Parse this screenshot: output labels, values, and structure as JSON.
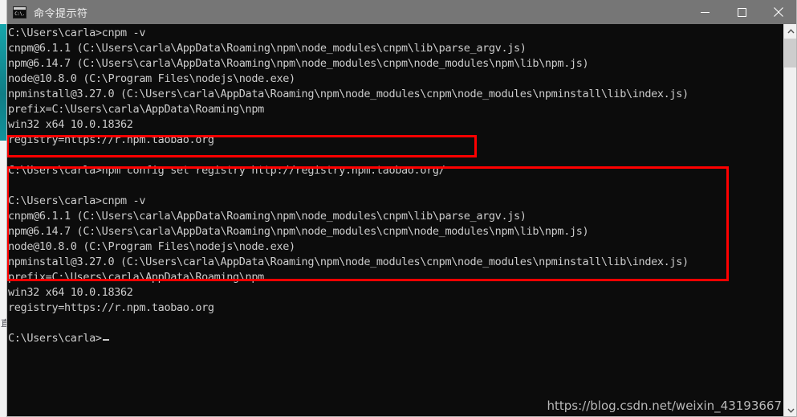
{
  "window": {
    "title": "命令提示符",
    "icon_label": "C:\\.",
    "icon_name": "console-icon",
    "buttons": {
      "minimize": "Minimize",
      "maximize": "Maximize",
      "close": "Close"
    }
  },
  "colors": {
    "titlebar": "#767676",
    "console_bg": "#0c0c0c",
    "console_fg": "#cccccc",
    "annotation_red": "#fe0000",
    "watermark": "#b9b9b9",
    "scrollbar_thumb": "#cdcdcd"
  },
  "terminal": {
    "lines": [
      "C:\\Users\\carla>cnpm -v",
      "cnpm@6.1.1 (C:\\Users\\carla\\AppData\\Roaming\\npm\\node_modules\\cnpm\\lib\\parse_argv.js)",
      "npm@6.14.7 (C:\\Users\\carla\\AppData\\Roaming\\npm\\node_modules\\cnpm\\node_modules\\npm\\lib\\npm.js)",
      "node@10.8.0 (C:\\Program Files\\nodejs\\node.exe)",
      "npminstall@3.27.0 (C:\\Users\\carla\\AppData\\Roaming\\npm\\node_modules\\cnpm\\node_modules\\npminstall\\lib\\index.js)",
      "prefix=C:\\Users\\carla\\AppData\\Roaming\\npm",
      "win32 x64 10.0.18362",
      "registry=https://r.npm.taobao.org",
      "",
      "C:\\Users\\carla>npm config set registry http://registry.npm.taobao.org/",
      "",
      "C:\\Users\\carla>cnpm -v",
      "cnpm@6.1.1 (C:\\Users\\carla\\AppData\\Roaming\\npm\\node_modules\\cnpm\\lib\\parse_argv.js)",
      "npm@6.14.7 (C:\\Users\\carla\\AppData\\Roaming\\npm\\node_modules\\cnpm\\node_modules\\npm\\lib\\npm.js)",
      "node@10.8.0 (C:\\Program Files\\nodejs\\node.exe)",
      "npminstall@3.27.0 (C:\\Users\\carla\\AppData\\Roaming\\npm\\node_modules\\cnpm\\node_modules\\npminstall\\lib\\index.js)",
      "prefix=C:\\Users\\carla\\AppData\\Roaming\\npm",
      "win32 x64 10.0.18362",
      "registry=https://r.npm.taobao.org",
      ""
    ],
    "prompt": "C:\\Users\\carla>"
  },
  "annotations": [
    {
      "name": "highlight-npm-config-command",
      "target_line": "C:\\Users\\carla>npm config set registry http://registry.npm.taobao.org/"
    },
    {
      "name": "highlight-cnpm-version-output",
      "target_line": "C:\\Users\\carla>cnpm -v"
    }
  ],
  "watermark": {
    "text": "https://blog.csdn.net/weixin_43193667"
  },
  "scrollbar": {
    "up_arrow": "scroll-up",
    "down_arrow": "scroll-down",
    "thumb": "scroll-thumb"
  },
  "background_window": {
    "glyph": "直"
  }
}
